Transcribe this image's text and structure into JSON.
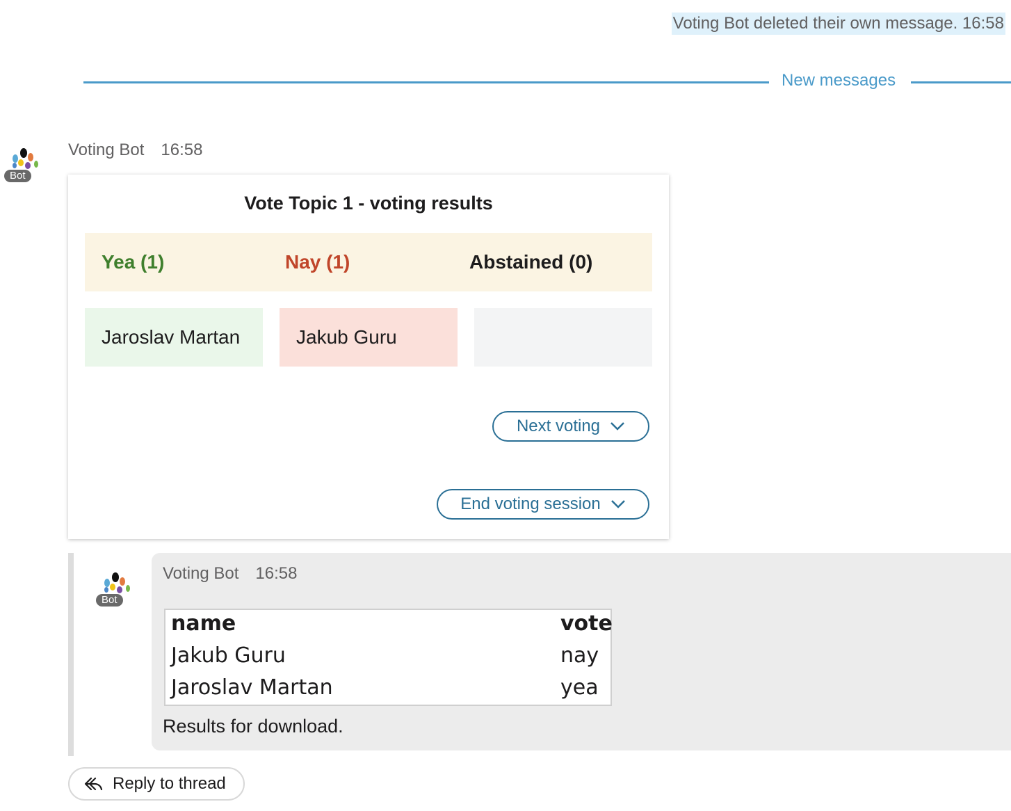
{
  "system_message": {
    "text": "Voting Bot deleted their own message. 16:58"
  },
  "divider": {
    "label": "New messages"
  },
  "message": {
    "author": "Voting Bot",
    "time": "16:58",
    "badge": "Bot",
    "avatar_icon": "hands-logo-icon",
    "card": {
      "title": "Vote Topic 1 - voting results",
      "columns": [
        {
          "label": "Yea (1)",
          "color": "#3f7f2d",
          "voters": [
            "Jaroslav Martan"
          ],
          "cell_color": "#eaf7ea"
        },
        {
          "label": "Nay (1)",
          "color": "#c0452a",
          "voters": [
            "Jakub Guru"
          ],
          "cell_color": "#fbe0da"
        },
        {
          "label": "Abstained (0)",
          "color": "#1d1c1d",
          "voters": [],
          "cell_color": "#f3f4f5"
        }
      ],
      "buttons": {
        "next_voting": "Next voting",
        "end_session": "End voting session"
      }
    }
  },
  "thread_reply": {
    "author": "Voting Bot",
    "time": "16:58",
    "badge": "Bot",
    "table": {
      "headers": [
        "name",
        "vote"
      ],
      "rows": [
        [
          "Jakub Guru",
          "nay"
        ],
        [
          "Jaroslav Martan",
          "yea"
        ]
      ]
    },
    "text": "Results for download."
  },
  "reply_button": {
    "label": "Reply to thread"
  },
  "colors": {
    "accent": "#4a9ac9",
    "button": "#2a6f95",
    "header_bg": "#fbf4e3",
    "system_highlight": "#dff1fb"
  }
}
